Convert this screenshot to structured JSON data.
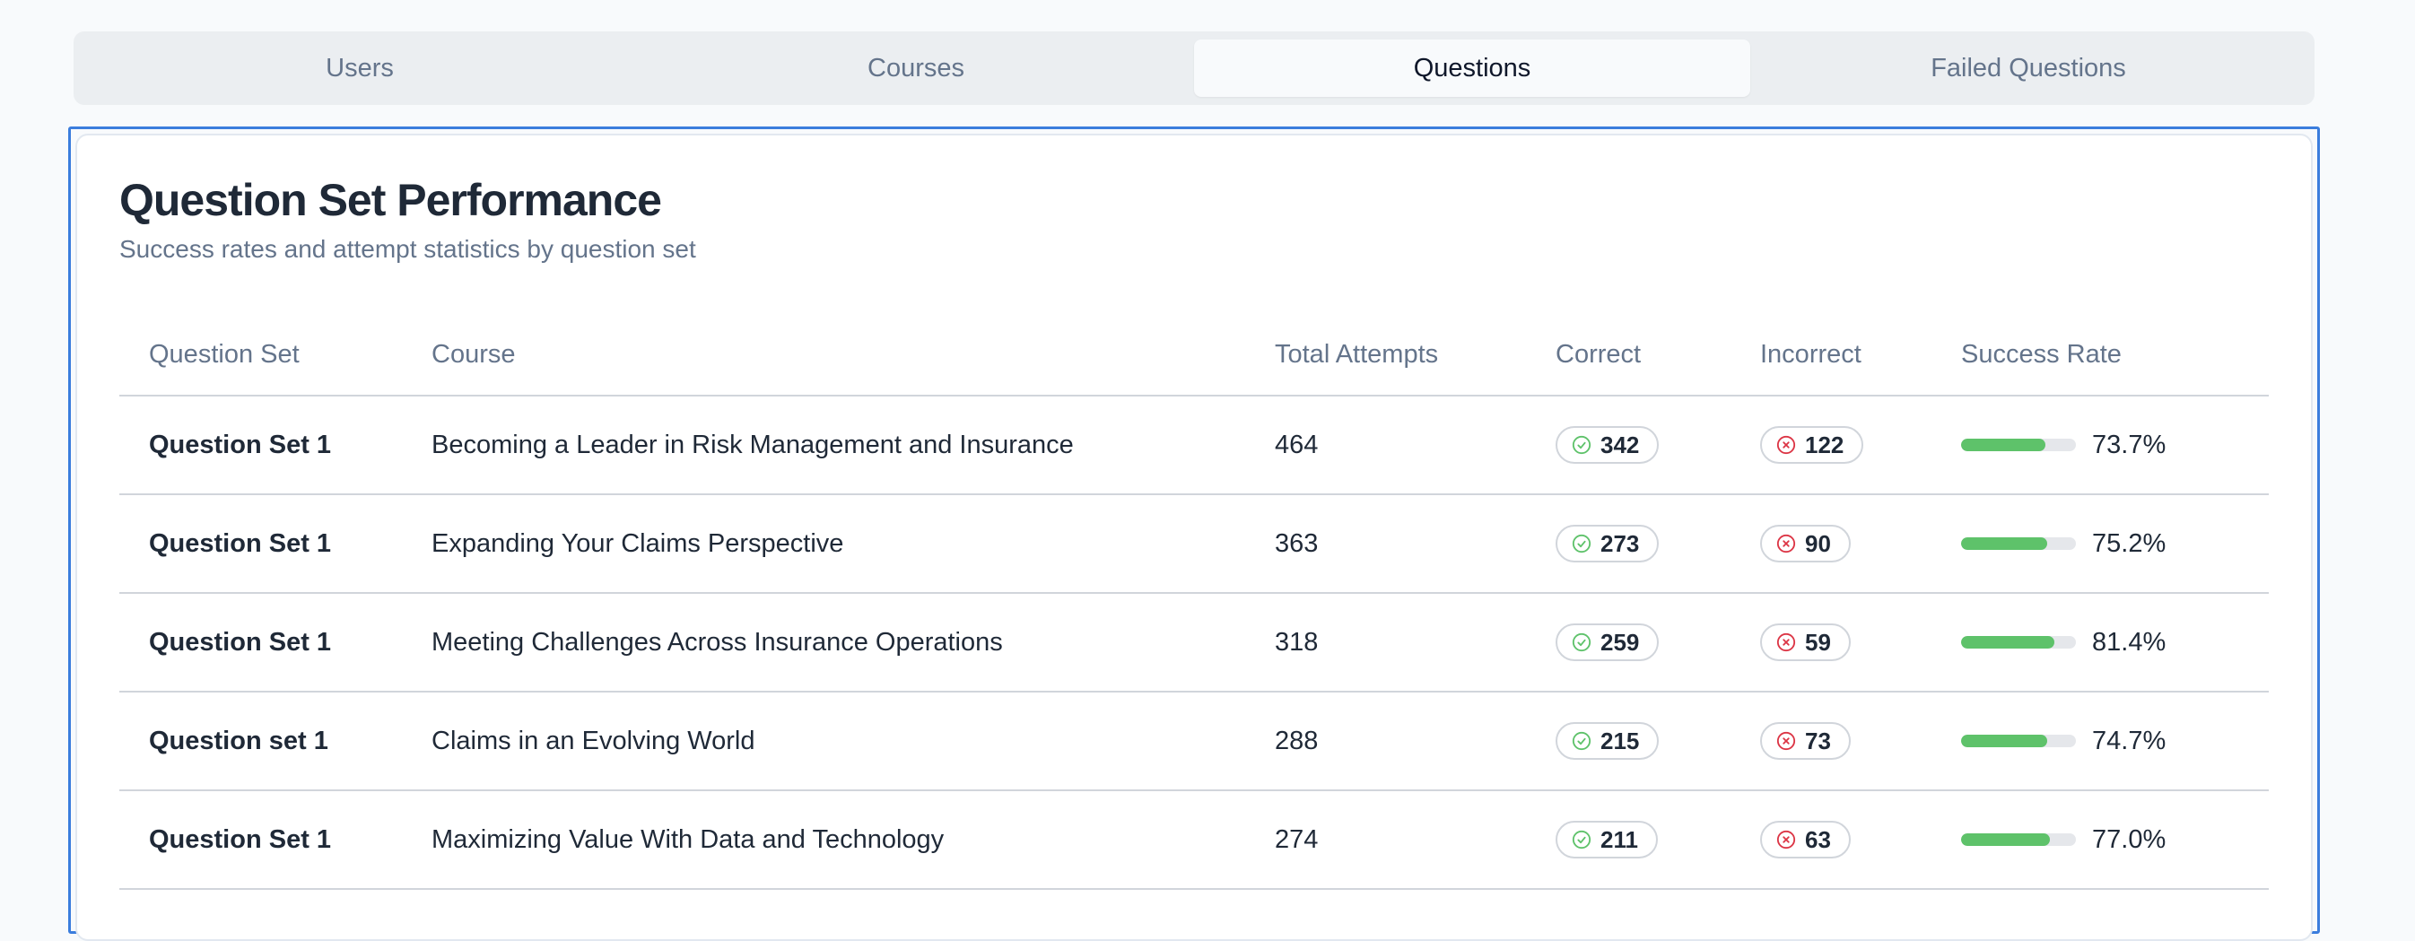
{
  "tabs": [
    {
      "label": "Users",
      "active": false
    },
    {
      "label": "Courses",
      "active": false
    },
    {
      "label": "Questions",
      "active": true
    },
    {
      "label": "Failed Questions",
      "active": false
    }
  ],
  "card": {
    "title": "Question Set Performance",
    "subtitle": "Success rates and attempt statistics by question set"
  },
  "table": {
    "headers": [
      "Question Set",
      "Course",
      "Total Attempts",
      "Correct",
      "Incorrect",
      "Success Rate"
    ],
    "rows": [
      {
        "set": "Question Set 1",
        "course": "Becoming a Leader in Risk Management and Insurance",
        "attempts": "464",
        "correct": "342",
        "incorrect": "122",
        "rate": "73.7%",
        "rate_value": 73.7
      },
      {
        "set": "Question Set 1",
        "course": "Expanding Your Claims Perspective",
        "attempts": "363",
        "correct": "273",
        "incorrect": "90",
        "rate": "75.2%",
        "rate_value": 75.2
      },
      {
        "set": "Question Set 1",
        "course": "Meeting Challenges Across Insurance Operations",
        "attempts": "318",
        "correct": "259",
        "incorrect": "59",
        "rate": "81.4%",
        "rate_value": 81.4
      },
      {
        "set": "Question set 1",
        "course": "Claims in an Evolving World",
        "attempts": "288",
        "correct": "215",
        "incorrect": "73",
        "rate": "74.7%",
        "rate_value": 74.7
      },
      {
        "set": "Question Set 1",
        "course": "Maximizing Value With Data and Technology",
        "attempts": "274",
        "correct": "211",
        "incorrect": "63",
        "rate": "77.0%",
        "rate_value": 77.0
      }
    ]
  },
  "icons": {
    "correct": "check-circle-icon",
    "incorrect": "x-circle-icon"
  },
  "colors": {
    "success": "#5ec26a",
    "error": "#dc3545",
    "accent": "#3b7ddd"
  }
}
